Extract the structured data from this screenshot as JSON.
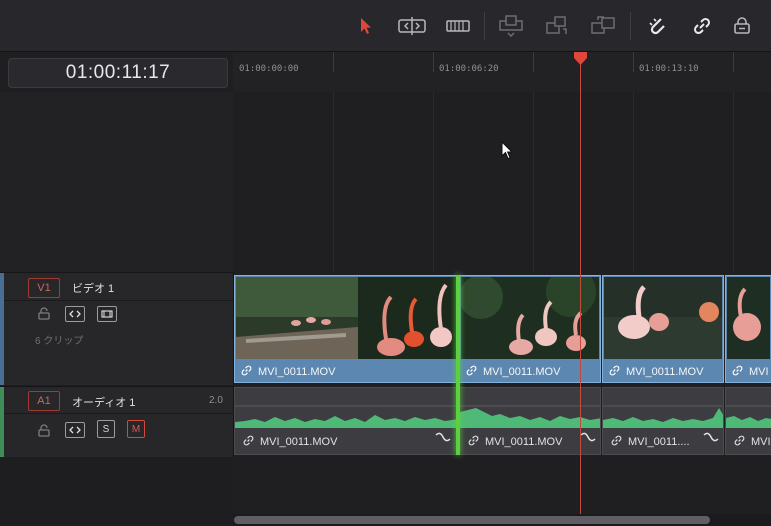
{
  "toolbar": {
    "tools": [
      {
        "name": "selection-mode-icon",
        "active": true
      },
      {
        "name": "trim-edit-mode-icon",
        "active": false
      },
      {
        "name": "blade-edit-mode-icon",
        "active": false
      },
      {
        "name": "insert-clip-icon",
        "active": false
      },
      {
        "name": "overwrite-clip-icon",
        "active": false
      },
      {
        "name": "replace-clip-icon",
        "active": false
      },
      {
        "name": "snapping-icon",
        "active": false
      },
      {
        "name": "linked-selection-icon",
        "active": false
      },
      {
        "name": "position-lock-icon",
        "active": false
      }
    ],
    "accent_color": "#e0473b"
  },
  "timecode": "01:00:11:17",
  "ruler": {
    "labels": [
      "01:00:00:00",
      "01:00:06:20",
      "01:00:13:10"
    ]
  },
  "tracks": {
    "video": {
      "id": "V1",
      "name": "ビデオ 1",
      "clip_count": "6 クリップ",
      "clips": [
        {
          "label": "MVI_0011.MOV"
        },
        {
          "label": "MVI_0011.MOV"
        },
        {
          "label": "MVI_0011.MOV"
        },
        {
          "label": "MVI"
        }
      ]
    },
    "audio": {
      "id": "A1",
      "name": "オーディオ 1",
      "channels": "2.0",
      "solo": "S",
      "mute": "M",
      "clips": [
        {
          "label": "MVI_0011.MOV"
        },
        {
          "label": "MVI_0011.MOV"
        },
        {
          "label": "MVI_0011...."
        },
        {
          "label": "MVI"
        }
      ]
    }
  },
  "colors": {
    "video_clip": "#5c87b0",
    "audio_wave": "#4fb977",
    "playhead": "#e0473b",
    "edit_point": "#5bd13f"
  }
}
